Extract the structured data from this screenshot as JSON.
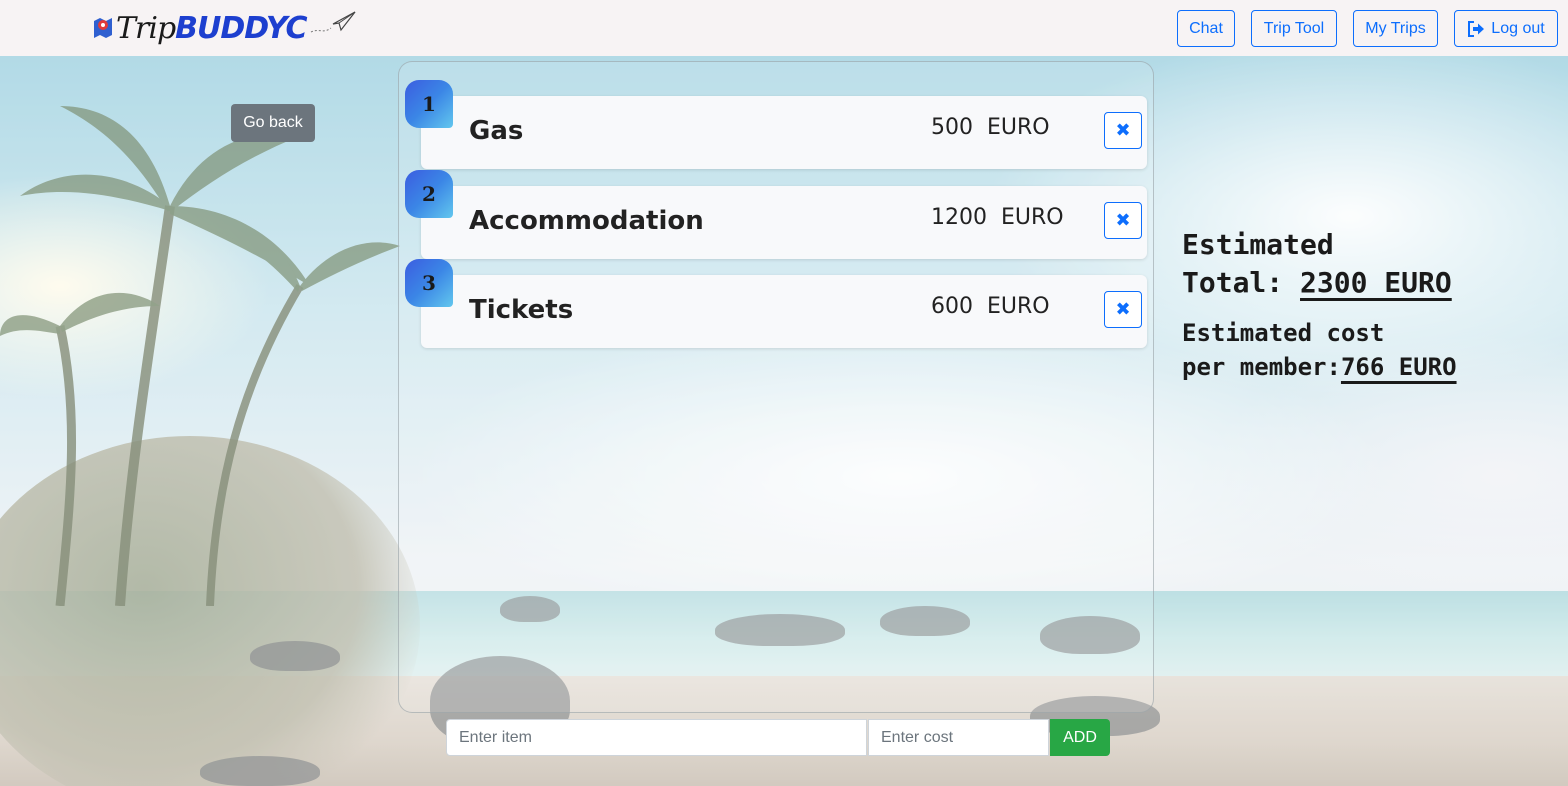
{
  "brand": {
    "part1": "Trip",
    "part2": "BUDDYC"
  },
  "nav": {
    "chat": "Chat",
    "trip_tool": "Trip Tool",
    "my_trips": "My Trips",
    "log_out": "Log out"
  },
  "go_back": "Go back",
  "items": [
    {
      "number": "1",
      "name": "Gas",
      "cost": "500  EURO",
      "delete": "✖"
    },
    {
      "number": "2",
      "name": "Accommodation",
      "cost": "1200  EURO",
      "delete": "✖"
    },
    {
      "number": "3",
      "name": "Tickets",
      "cost": "600  EURO",
      "delete": "✖"
    }
  ],
  "form": {
    "item_placeholder": "Enter item",
    "cost_placeholder": "Enter cost",
    "add_label": "ADD"
  },
  "totals": {
    "total_label_1": "Estimated",
    "total_label_2": "Total: ",
    "total_value": "2300 EURO",
    "member_label_1": "Estimated cost",
    "member_label_2": "per member:",
    "member_value": "766 EURO"
  },
  "colors": {
    "primary": "#0d6efd",
    "secondary": "#6c757d",
    "success": "#28a745",
    "brand_blue": "#1d3fcf"
  }
}
